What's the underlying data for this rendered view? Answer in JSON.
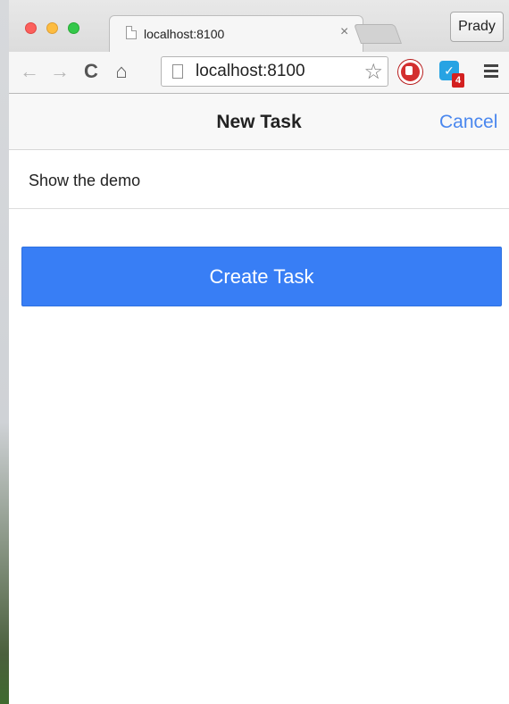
{
  "browser": {
    "tab_title": "localhost:8100",
    "tab_close": "×",
    "profile_name": "Prady",
    "url": "localhost:8100",
    "nav_icons": {
      "back": "←",
      "forward": "→",
      "reload": "C",
      "home": "⌂",
      "star": "☆"
    },
    "extension_badge": "4"
  },
  "app": {
    "header_title": "New Task",
    "cancel_label": "Cancel",
    "task_input_value": "Show the demo",
    "create_button_label": "Create Task"
  },
  "colors": {
    "accent": "#387ef5",
    "link": "#4a87ee"
  }
}
